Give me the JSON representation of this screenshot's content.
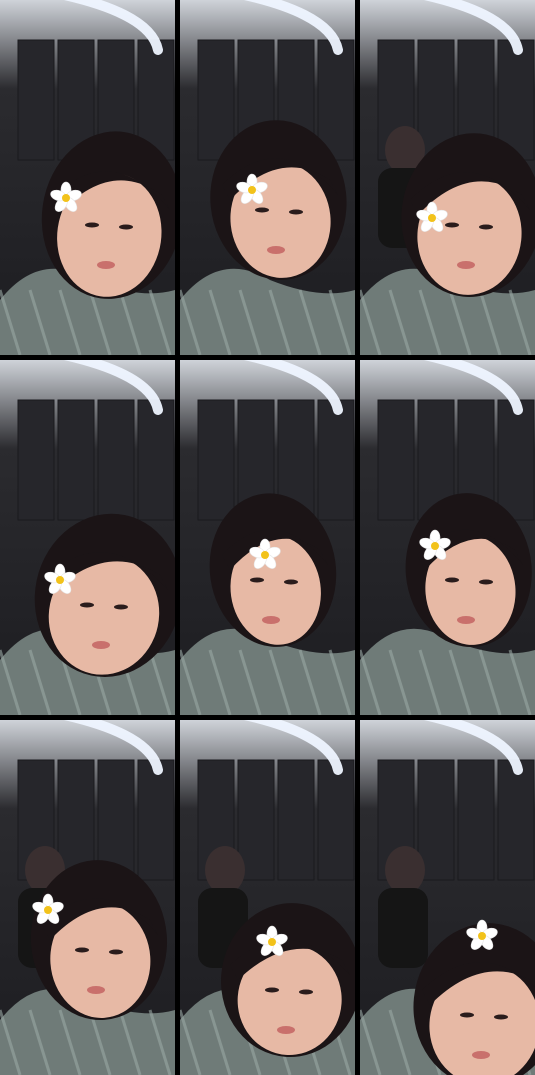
{
  "grid": {
    "rows": 3,
    "cols": 3
  },
  "colors": {
    "background": "#000000",
    "wall": "#2b2b2f",
    "ceiling_light": "#eef4ff",
    "skin": "#e7b9a5",
    "hair": "#1b1416",
    "shirt": "#6f7b78",
    "shirt_plaid": "#9aa8a4",
    "flower_petal": "#ffffff",
    "flower_center": "#f2c21a"
  },
  "tiles": [
    {
      "id": "r1c1",
      "flower": true,
      "second_person": false
    },
    {
      "id": "r1c2",
      "flower": true,
      "second_person": false
    },
    {
      "id": "r1c3",
      "flower": true,
      "second_person": true
    },
    {
      "id": "r2c1",
      "flower": true,
      "second_person": false
    },
    {
      "id": "r2c2",
      "flower": true,
      "second_person": false
    },
    {
      "id": "r2c3",
      "flower": true,
      "second_person": false
    },
    {
      "id": "r3c1",
      "flower": true,
      "second_person": true
    },
    {
      "id": "r3c2",
      "flower": true,
      "second_person": true
    },
    {
      "id": "r3c3",
      "flower": true,
      "second_person": true
    }
  ]
}
